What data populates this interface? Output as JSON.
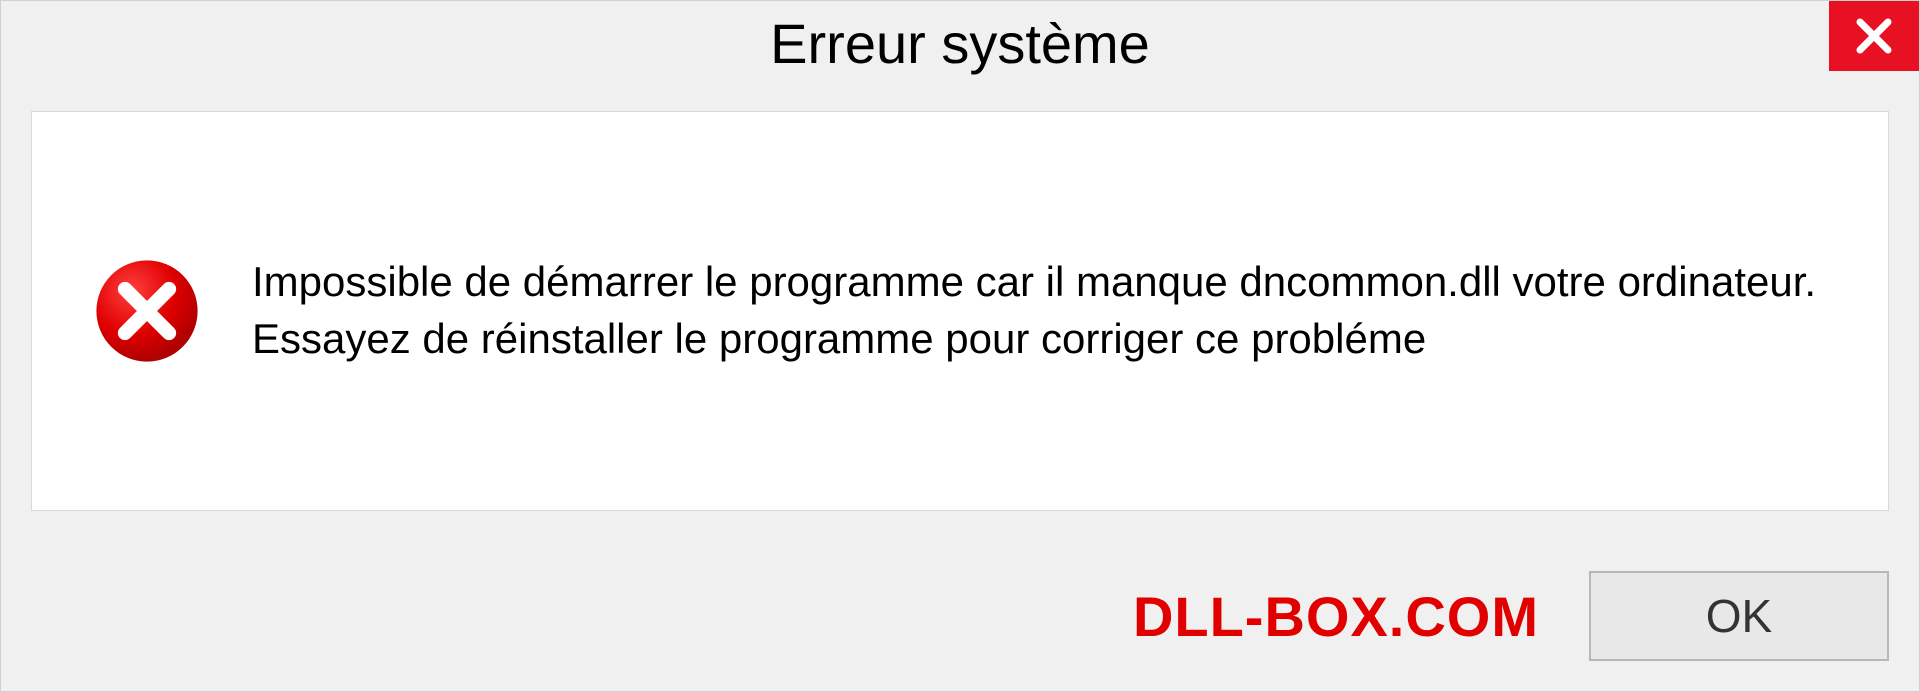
{
  "dialog": {
    "title": "Erreur système",
    "message": "Impossible de démarrer le programme car il manque dncommon.dll votre ordinateur. Essayez de réinstaller le programme pour corriger ce probléme",
    "ok_label": "OK",
    "watermark": "DLL-BOX.COM"
  }
}
